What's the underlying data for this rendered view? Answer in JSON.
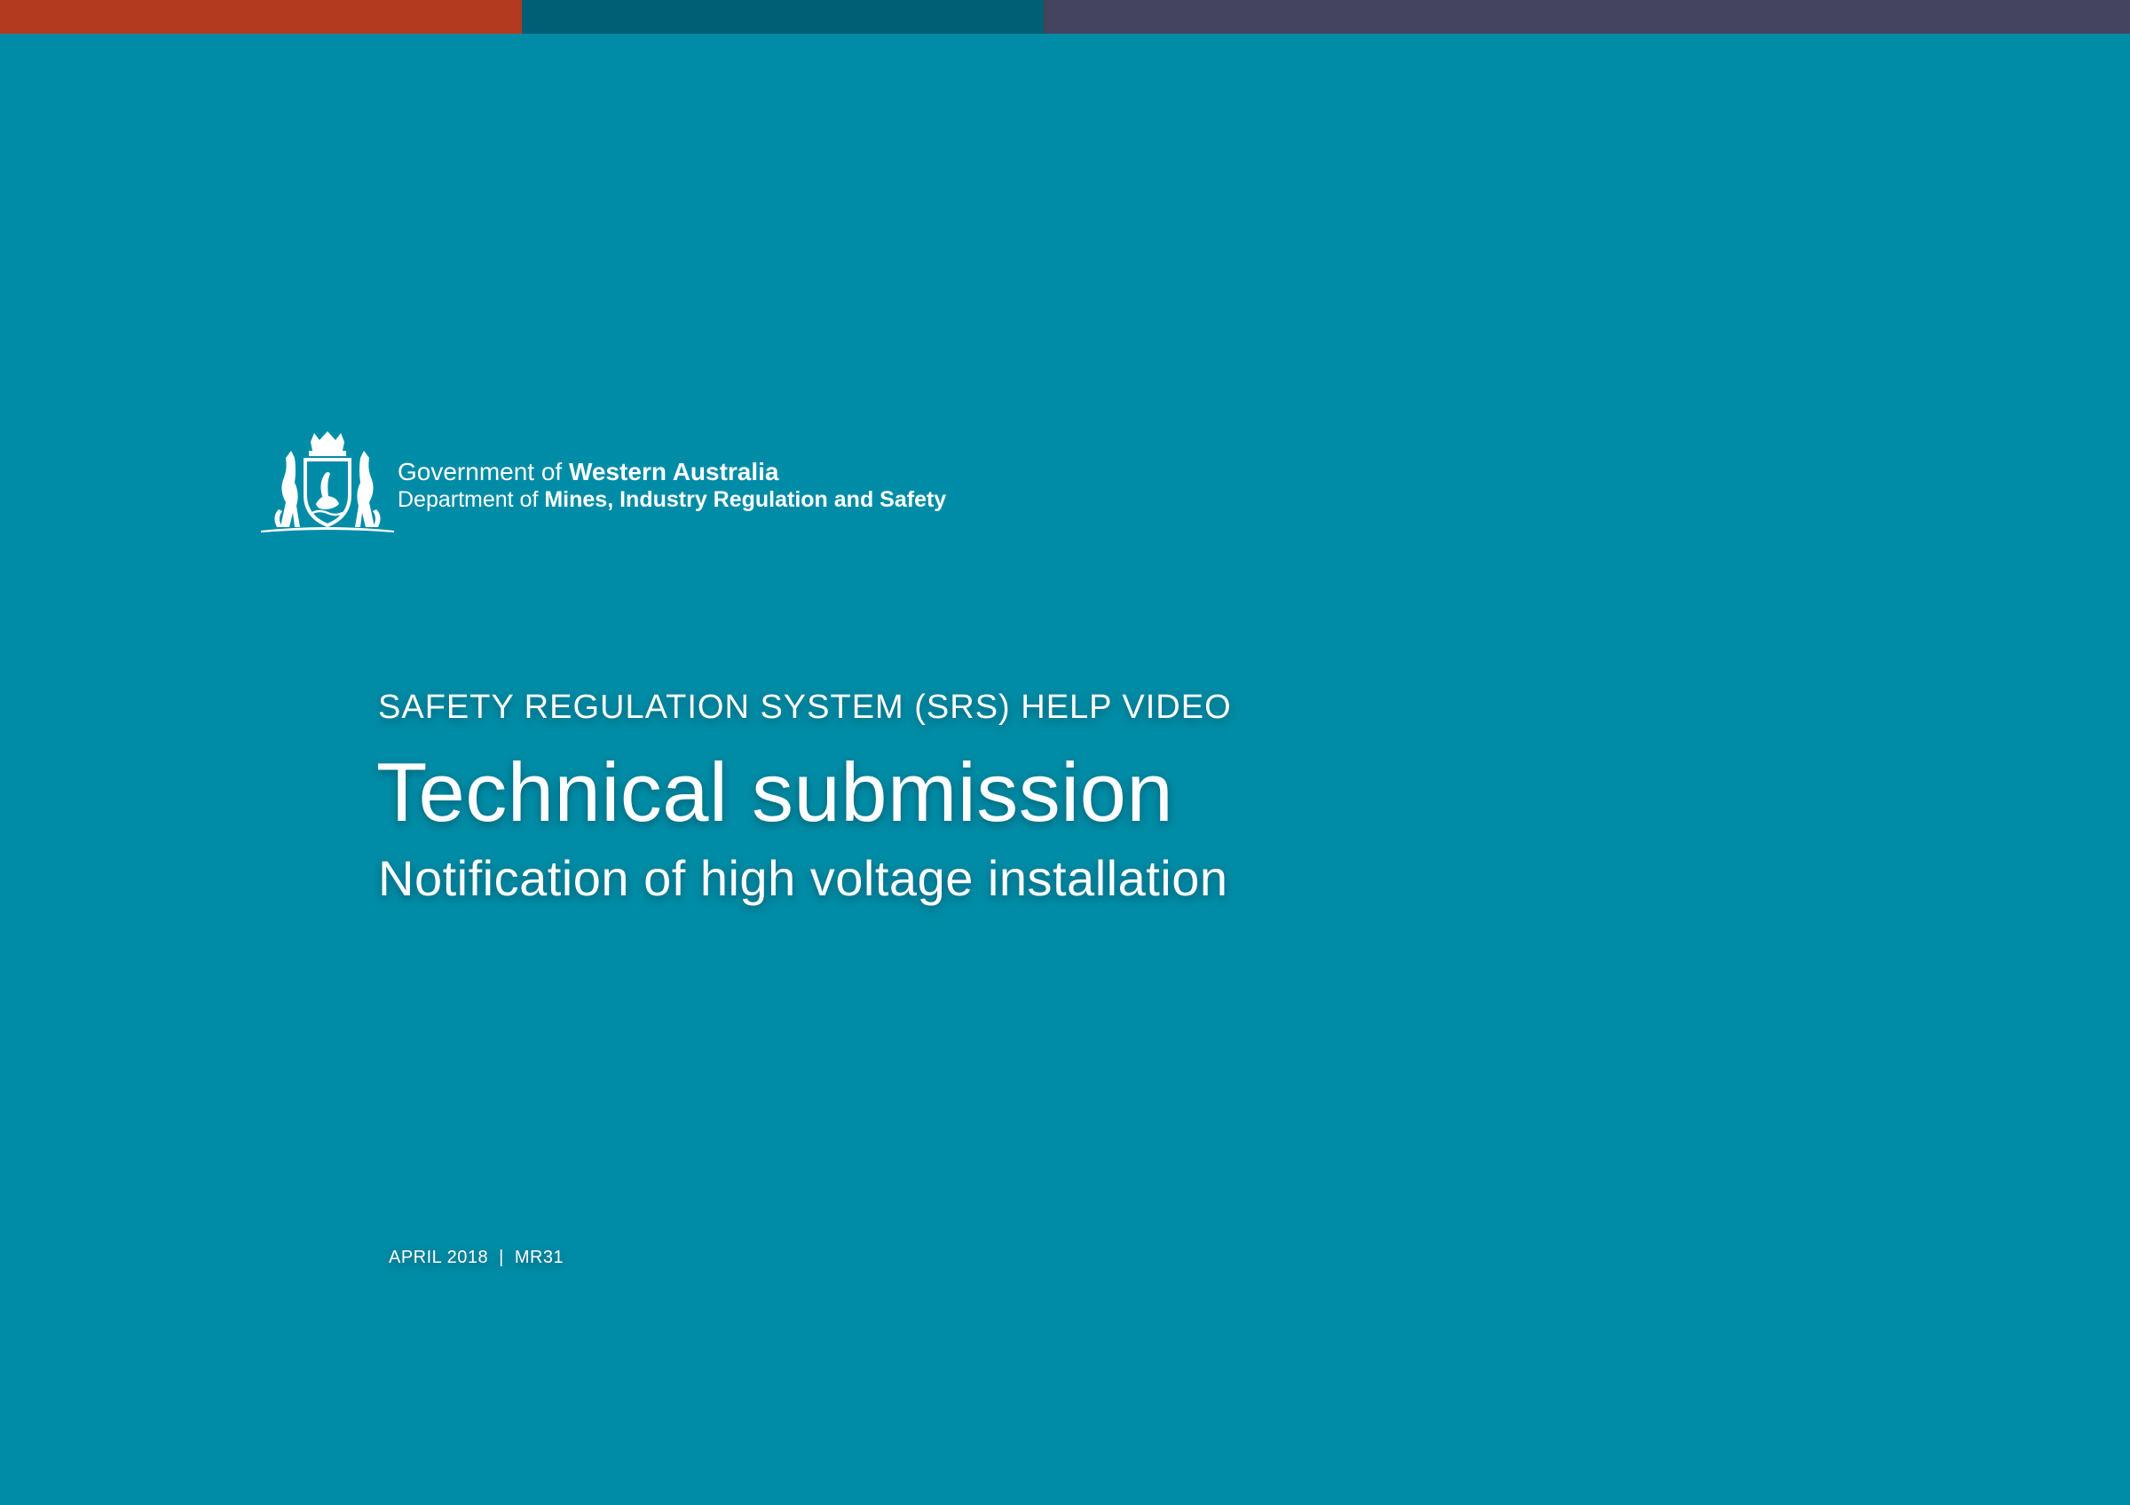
{
  "top_bar": {
    "segments": [
      {
        "name": "red",
        "color": "#b33a1e"
      },
      {
        "name": "dark-teal",
        "color": "#005f75"
      },
      {
        "name": "slate",
        "color": "#45445e"
      }
    ]
  },
  "logo": {
    "icon": "wa-coat-of-arms-icon",
    "line1_prefix": "Government of ",
    "line1_bold": "Western Australia",
    "line2_prefix": "Department of ",
    "line2_bold": "Mines, Industry Regulation and Safety"
  },
  "eyebrow": "SAFETY REGULATION SYSTEM (SRS) HELP VIDEO",
  "title": "Technical submission",
  "subtitle": "Notification of high voltage installation",
  "meta": {
    "date": "APRIL 2018",
    "separator": "|",
    "code": "MR31"
  },
  "colors": {
    "background": "#008ca6",
    "text": "#ffffff"
  }
}
